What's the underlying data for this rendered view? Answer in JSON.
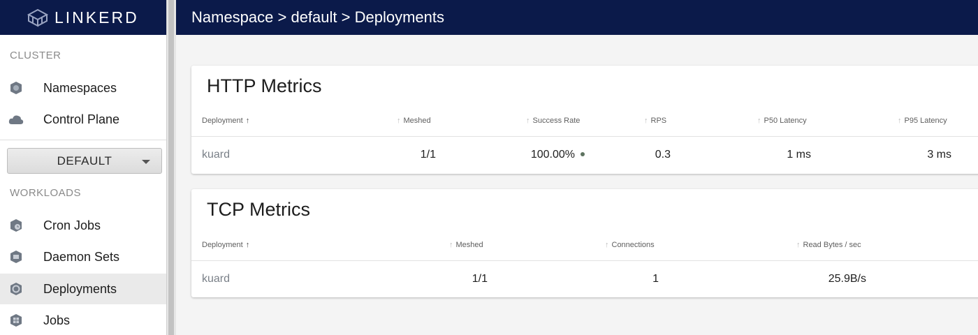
{
  "brand": {
    "name": "LINKERD"
  },
  "header": {
    "breadcrumb": "Namespace > default > Deployments"
  },
  "sidebar": {
    "cluster_label": "CLUSTER",
    "cluster_items": [
      {
        "label": "Namespaces",
        "icon": "namespace-icon"
      },
      {
        "label": "Control Plane",
        "icon": "cloud-icon"
      }
    ],
    "namespace_select": {
      "value": "DEFAULT"
    },
    "workloads_label": "WORKLOADS",
    "workload_items": [
      {
        "label": "Cron Jobs",
        "icon": "cronjob-icon",
        "active": false
      },
      {
        "label": "Daemon Sets",
        "icon": "daemonset-icon",
        "active": false
      },
      {
        "label": "Deployments",
        "icon": "deployment-icon",
        "active": true
      },
      {
        "label": "Jobs",
        "icon": "job-icon",
        "active": false
      }
    ]
  },
  "http_metrics": {
    "title": "HTTP Metrics",
    "columns": [
      "Deployment",
      "Meshed",
      "Success Rate",
      "RPS",
      "P50 Latency",
      "P95 Latency"
    ],
    "rows": [
      {
        "deployment": "kuard",
        "meshed": "1/1",
        "success_rate": "100.00%",
        "rps": "0.3",
        "p50": "1 ms",
        "p95": "3 ms"
      }
    ]
  },
  "tcp_metrics": {
    "title": "TCP Metrics",
    "columns": [
      "Deployment",
      "Meshed",
      "Connections",
      "Read Bytes / sec"
    ],
    "rows": [
      {
        "deployment": "kuard",
        "meshed": "1/1",
        "connections": "1",
        "read_bytes": "25.9B/s"
      }
    ]
  },
  "colors": {
    "nav_bg": "#0b1a4a",
    "success_dot": "#5e7360"
  }
}
